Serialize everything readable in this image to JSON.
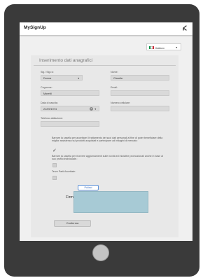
{
  "app": {
    "title": "MySignUp",
    "back_icon": "back-arrow-icon"
  },
  "language": {
    "label": "Italiano",
    "flag_colors": [
      "#009246",
      "#ffffff",
      "#ce2b37"
    ]
  },
  "form": {
    "section_title": "Inserimento dati anagrafici",
    "fields": {
      "salutation": {
        "label": "Sig./ Sig.ra:",
        "value": "Donna"
      },
      "name": {
        "label": "Nome:",
        "value": "Claudia"
      },
      "surname": {
        "label": "Cognome:",
        "value": "Moretti"
      },
      "email": {
        "label": "Email:",
        "value": ""
      },
      "birth_date": {
        "label": "Data di nascita:",
        "value": "21/09/1974"
      },
      "mobile": {
        "label": "Numero cellulare:",
        "value": ""
      },
      "phone": {
        "label": "Telefono abitazione:",
        "value": ""
      }
    },
    "consents": [
      {
        "text": "Barrare la casella per accettare il trattamento dei suoi dati personali al fine di poter beneficiare della miglior assistenza sui prodotti acquistati e partecipare ad indagini di mercato:",
        "checked": true
      },
      {
        "text": "Barrare la casella per ricevere aggiornamenti sulle novità ed iniziative promozionali anche in base al suo profilo individuale.:",
        "checked": false
      },
      {
        "text": "Terze Parti Accettate:",
        "checked": false
      }
    ],
    "clear_label": "Pulisci",
    "signature_label": "Firma:",
    "confirm_label": "Conferma"
  },
  "colors": {
    "signature_pad": "#a7cad5",
    "device_frame": "#3a3a3a"
  }
}
